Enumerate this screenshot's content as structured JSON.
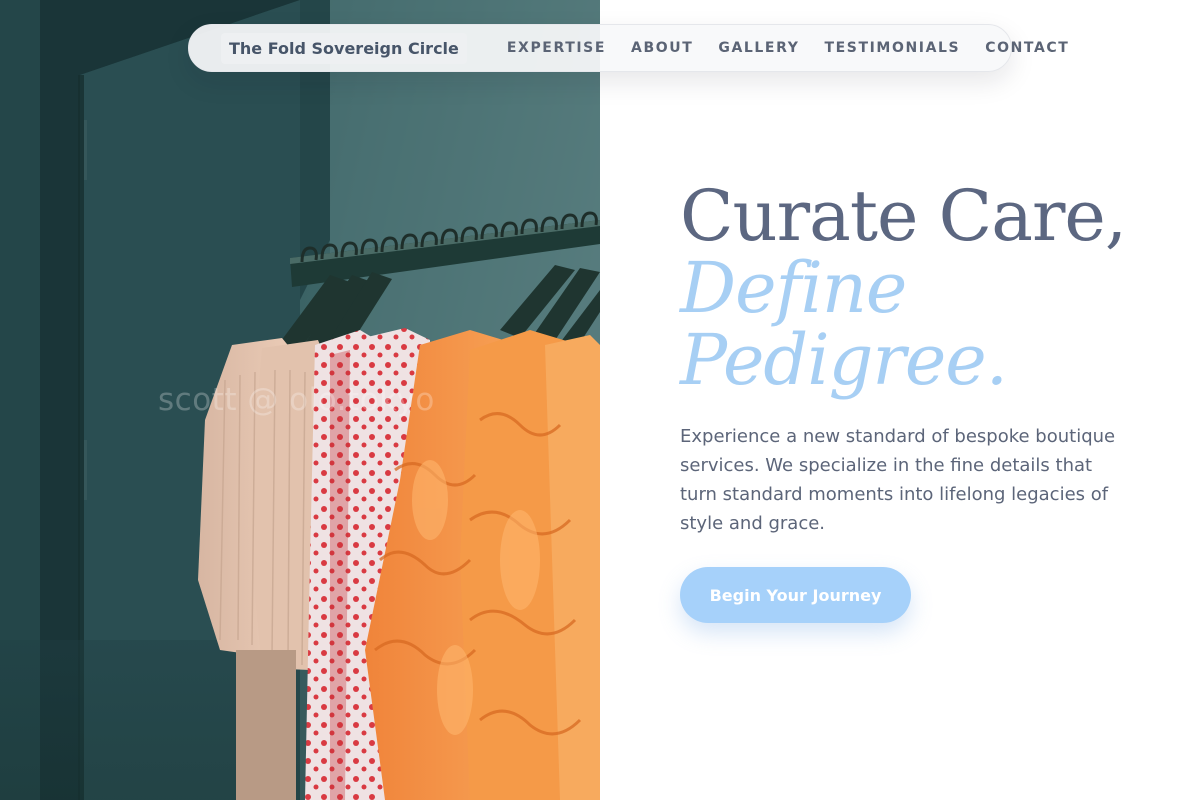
{
  "nav": {
    "brand": "The Fold Sovereign Circle",
    "links": [
      {
        "label": "EXPERTISE"
      },
      {
        "label": "ABOUT"
      },
      {
        "label": "GALLERY"
      },
      {
        "label": "TESTIMONIALS"
      },
      {
        "label": "CONTACT"
      }
    ]
  },
  "hero": {
    "headline_line1": "Curate Care,",
    "headline_line2": "Define",
    "headline_line3": "Pedigree.",
    "description": "Experience a new standard of bespoke boutique services. We specialize in the fine details that turn standard moments into lifelong legacies of style and grace.",
    "cta_label": "Begin Your Journey"
  },
  "image": {
    "subject": "clothing rack with garments on hangers",
    "watermark": "scott @ olo.tokyo"
  },
  "colors": {
    "headline": "#5c6781",
    "accent": "#a7cff4",
    "button": "#a6d1fa",
    "body_text": "#5c6579"
  }
}
